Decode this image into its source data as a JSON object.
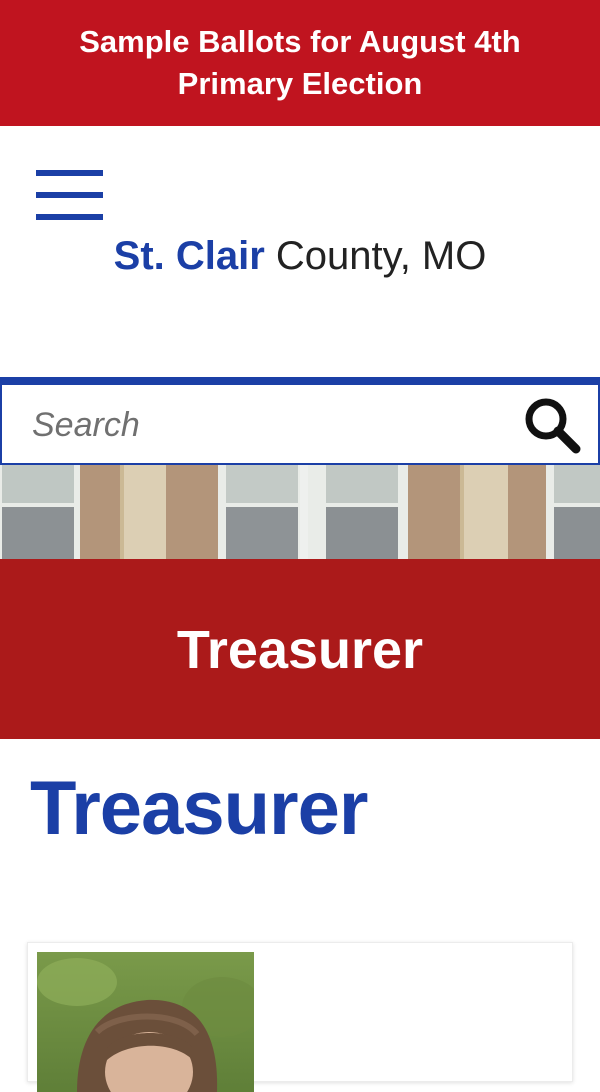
{
  "alert": {
    "text": "Sample Ballots for August 4th Primary Election"
  },
  "menu": {
    "icon": "hamburger-menu-icon"
  },
  "site": {
    "name_bold": "St. Clair",
    "name_rest": "County, MO"
  },
  "search": {
    "placeholder": "Search",
    "value": "",
    "icon": "search-icon"
  },
  "page": {
    "header_title": "Treasurer",
    "title": "Treasurer"
  },
  "colors": {
    "alert_red": "#c0141f",
    "header_red": "#ab1a1a",
    "brand_blue": "#1b3fa6"
  }
}
